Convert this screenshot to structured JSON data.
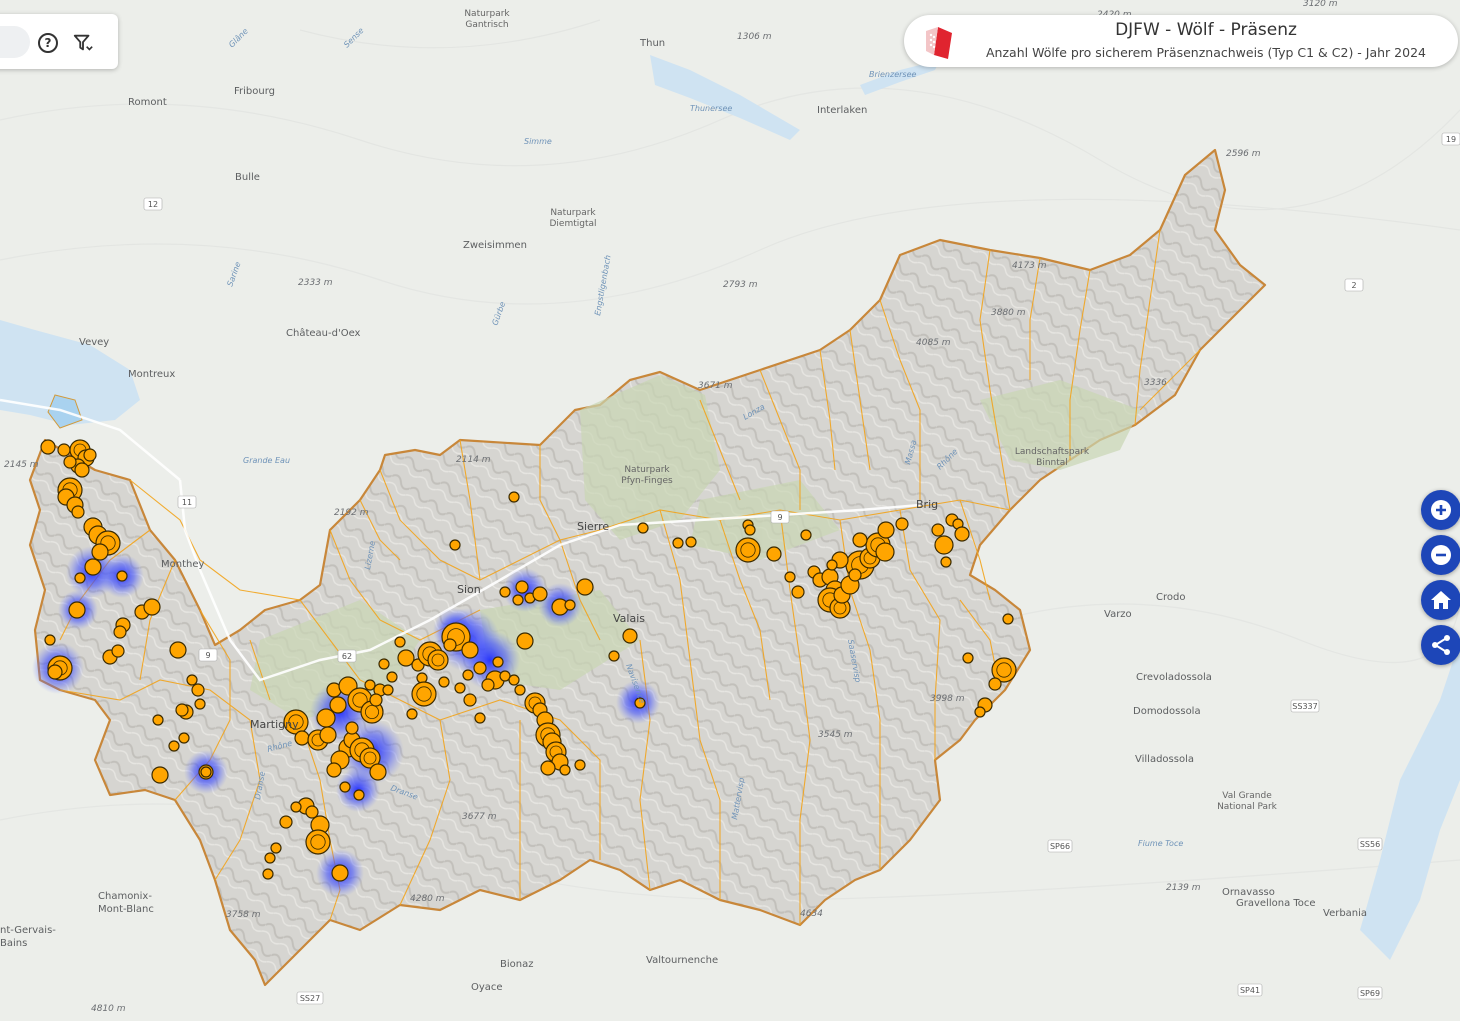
{
  "header": {
    "title": "DJFW - Wölf - Präsenz",
    "subtitle": "Anzahl Wölfe pro sicherem Präsenznachweis (Typ C1 & C2) - Jahr 2024"
  },
  "toolbar": {
    "help_icon": "question-circle-icon",
    "filter_icon": "filter-icon"
  },
  "controls": {
    "zoom_in_icon": "plus-icon",
    "zoom_out_icon": "minus-icon",
    "home_icon": "home-icon",
    "share_icon": "share-icon",
    "accent": "#1d46b8"
  },
  "colors": {
    "marker_fill": "#ffa500",
    "marker_stroke": "#3a2a00",
    "heat": "#2a3cff",
    "border": "#e1a03a",
    "canton_fill": "#d9d8d4",
    "lake": "#cfe3f2"
  },
  "places": [
    {
      "name": "Thun"
    },
    {
      "name": "Romont"
    },
    {
      "name": "Fribourg"
    },
    {
      "name": "Bulle"
    },
    {
      "name": "Interlaken"
    },
    {
      "name": "Zweisimmen"
    },
    {
      "name": "Château-d'Oex"
    },
    {
      "name": "Vevey"
    },
    {
      "name": "Montreux"
    },
    {
      "name": "Monthey"
    },
    {
      "name": "Sion"
    },
    {
      "name": "Sierre"
    },
    {
      "name": "Martigny"
    },
    {
      "name": "Brig"
    },
    {
      "name": "Valais"
    },
    {
      "name": "Varzo"
    },
    {
      "name": "Crodo"
    },
    {
      "name": "Crevoladossola"
    },
    {
      "name": "Domodossola"
    },
    {
      "name": "Villadossola"
    },
    {
      "name": "Ornavasso"
    },
    {
      "name": "Gravellona Toce"
    },
    {
      "name": "Verbania"
    },
    {
      "name": "Chamonix-"
    },
    {
      "name": "Mont-Blanc"
    },
    {
      "name": "nt-Gervais-"
    },
    {
      "name": "Bains"
    },
    {
      "name": "Bionaz"
    },
    {
      "name": "Oyace"
    },
    {
      "name": "Valtournenche"
    }
  ],
  "parks": [
    {
      "line1": "Naturpark",
      "line2": "Gantrisch"
    },
    {
      "line1": "Naturpark",
      "line2": "Diemtigtal"
    },
    {
      "line1": "Naturpark",
      "line2": "Pfyn-Finges"
    },
    {
      "line1": "Landschaftspark",
      "line2": "Binntal"
    },
    {
      "line1": "Val Grande",
      "line2": "National Park"
    }
  ],
  "peaks": [
    {
      "label": "1306 m"
    },
    {
      "label": "2333 m"
    },
    {
      "label": "2793 m"
    },
    {
      "label": "2596 m"
    },
    {
      "label": "4173 m"
    },
    {
      "label": "3880 m"
    },
    {
      "label": "4085 m"
    },
    {
      "label": "3671 m"
    },
    {
      "label": "2145 m"
    },
    {
      "label": "2192 m"
    },
    {
      "label": "2114 m"
    },
    {
      "label": "3677 m"
    },
    {
      "label": "4280 m"
    },
    {
      "label": "3758 m"
    },
    {
      "label": "3998 m"
    },
    {
      "label": "3545 m"
    },
    {
      "label": "4634"
    },
    {
      "label": "2139 m"
    },
    {
      "label": "4810 m"
    },
    {
      "label": "3120 m"
    },
    {
      "label": "2420 m"
    },
    {
      "label": "3336"
    }
  ],
  "waters": [
    {
      "label": "Thunersee"
    },
    {
      "label": "Brienzersee"
    },
    {
      "label": "Simme"
    },
    {
      "label": "Sarine"
    },
    {
      "label": "Grande Eau"
    },
    {
      "label": "Rhône"
    },
    {
      "label": "Lonza"
    },
    {
      "label": "Massa"
    },
    {
      "label": "Rhône"
    },
    {
      "label": "Navisence"
    },
    {
      "label": "Mattervisp"
    },
    {
      "label": "Saaservisp"
    },
    {
      "label": "Dranse"
    },
    {
      "label": "Dranse"
    },
    {
      "label": "Fiume Toce"
    },
    {
      "label": "Glâne"
    },
    {
      "label": "Sense"
    },
    {
      "label": "Lizerne"
    },
    {
      "label": "Engstligenbach"
    },
    {
      "label": "Gürbe"
    }
  ],
  "roads": [
    {
      "label": "12"
    },
    {
      "label": "11"
    },
    {
      "label": "9"
    },
    {
      "label": "62"
    },
    {
      "label": "9"
    },
    {
      "label": "2"
    },
    {
      "label": "19"
    },
    {
      "label": "SS337"
    },
    {
      "label": "SP66"
    },
    {
      "label": "SS56"
    },
    {
      "label": "SP41"
    },
    {
      "label": "SP69"
    },
    {
      "label": "SS27"
    }
  ]
}
